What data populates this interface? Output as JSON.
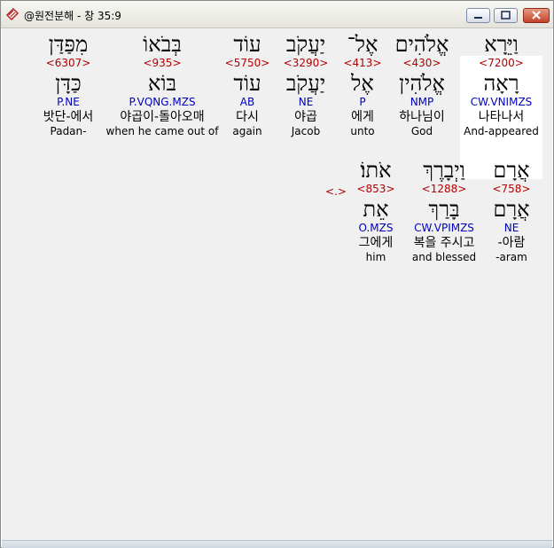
{
  "window": {
    "title": "@원전분해 - 창 35:9"
  },
  "colors": {
    "strong": "#b00000",
    "morph": "#0000c0",
    "highlight": "#ffffff"
  },
  "row1": [
    {
      "heb": "וַיֵּרָא",
      "strong": "<7200>",
      "lemma": "רָאָה",
      "morph": "CW.VNIMZS",
      "kor": "나타나서",
      "eng": "And-appeared"
    },
    {
      "heb": "אֱלֹהִים",
      "strong": "<430>",
      "lemma": "אֱלֹהִין",
      "morph": "NMP",
      "kor": "하나님이",
      "eng": "God"
    },
    {
      "heb": "אֶל־",
      "strong": "<413>",
      "lemma": "אֶל",
      "morph": "P",
      "kor": "에게",
      "eng": "unto"
    },
    {
      "heb": "יַעֲקֹב",
      "strong": "<3290>",
      "lemma": "יַעֲקֹב",
      "morph": "NE",
      "kor": "야곱",
      "eng": "Jacob"
    },
    {
      "heb": "עוֹד",
      "strong": "<5750>",
      "lemma": "עוֹד",
      "morph": "AB",
      "kor": "다시",
      "eng": "again"
    },
    {
      "heb": "בְּבֹאוֹ",
      "strong": "<935>",
      "lemma": "בּוֹא",
      "morph": "P.VQNG.MZS",
      "kor": "야곱이-돌아오매",
      "eng": "when he came out of"
    },
    {
      "heb": "מִפַּדַּן",
      "strong": "<6307>",
      "lemma": "כַּדָּן",
      "morph": "P.NE",
      "kor": "밧단-에서",
      "eng": "Padan-"
    }
  ],
  "row2": [
    {
      "heb": "אֲרָם",
      "strong": "<758>",
      "lemma": "אֲרָם",
      "morph": "NE",
      "kor": "-아람",
      "eng": "-aram"
    },
    {
      "heb": "וַיְבָרֶךְ",
      "strong": "<1288>",
      "lemma": "בָּרַךְ",
      "morph": "CW.VPIMZS",
      "kor": "복을 주시고",
      "eng": "and blessed"
    },
    {
      "heb": "אֹתוֹ׃",
      "strong": "<853>",
      "lemma": "אֵת",
      "morph": "O.MZS",
      "kor": "그에게",
      "eng": "him"
    }
  ],
  "row2_marker": "<.>"
}
